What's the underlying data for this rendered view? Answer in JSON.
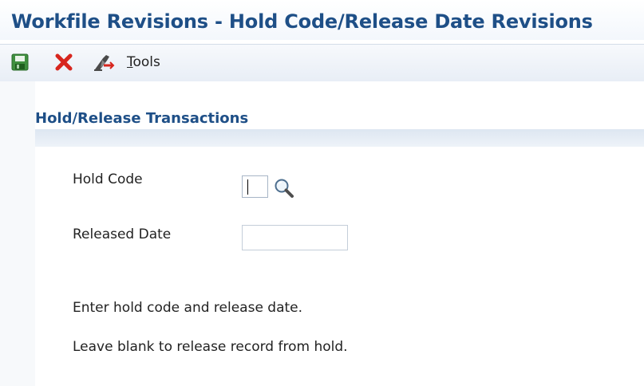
{
  "window": {
    "title": "Workfile Revisions - Hold Code/Release Date Revisions"
  },
  "toolbar": {
    "save_icon": "save-icon",
    "cancel_icon": "cancel-icon",
    "tools_icon": "tools-icon",
    "tools_label_underlined": "T",
    "tools_label_rest": "ools"
  },
  "section": {
    "title": "Hold/Release Transactions"
  },
  "form": {
    "hold_code": {
      "label": "Hold Code",
      "value": ""
    },
    "released_date": {
      "label": "Released Date",
      "value": ""
    }
  },
  "instructions": {
    "line1": "Enter hold code and release date.",
    "line2": "Leave blank to release record from hold."
  }
}
